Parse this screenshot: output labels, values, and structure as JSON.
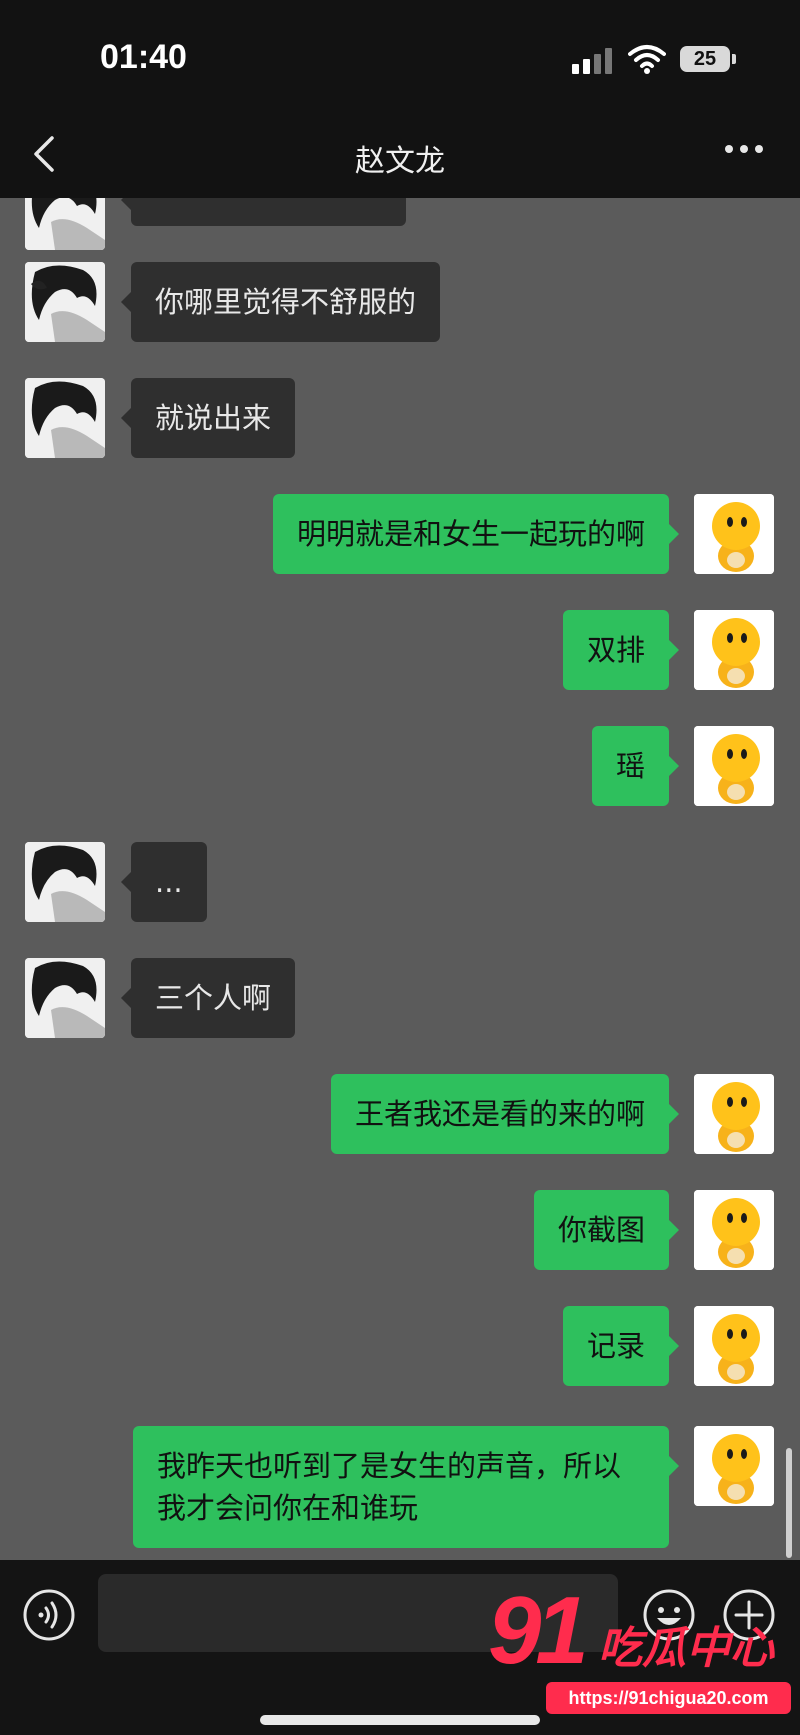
{
  "status_bar": {
    "time": "01:40",
    "battery": "25"
  },
  "header": {
    "title": "赵文龙"
  },
  "messages": [
    {
      "side": "left",
      "text": "你哪里觉得不舒服的"
    },
    {
      "side": "left",
      "text": "就说出来"
    },
    {
      "side": "right",
      "text": "明明就是和女生一起玩的啊"
    },
    {
      "side": "right",
      "text": "双排"
    },
    {
      "side": "right",
      "text": "瑶"
    },
    {
      "side": "left",
      "text": "..."
    },
    {
      "side": "left",
      "text": "三个人啊"
    },
    {
      "side": "right",
      "text": "王者我还是看的来的啊"
    },
    {
      "side": "right",
      "text": "你截图"
    },
    {
      "side": "right",
      "text": "记录"
    },
    {
      "side": "right",
      "text": "我昨天也听到了是女生的声音，所以我才会问你在和谁玩"
    }
  ],
  "watermark": {
    "number": "91",
    "name": "吃瓜中心",
    "url": "https://91chigua20.com"
  },
  "colors": {
    "sent_bubble": "#2ec05d",
    "received_bubble": "#2f2f2f",
    "watermark": "#ff2c4d"
  },
  "icons": [
    "back-icon",
    "more-icon",
    "voice-icon",
    "emoji-icon",
    "plus-icon"
  ]
}
